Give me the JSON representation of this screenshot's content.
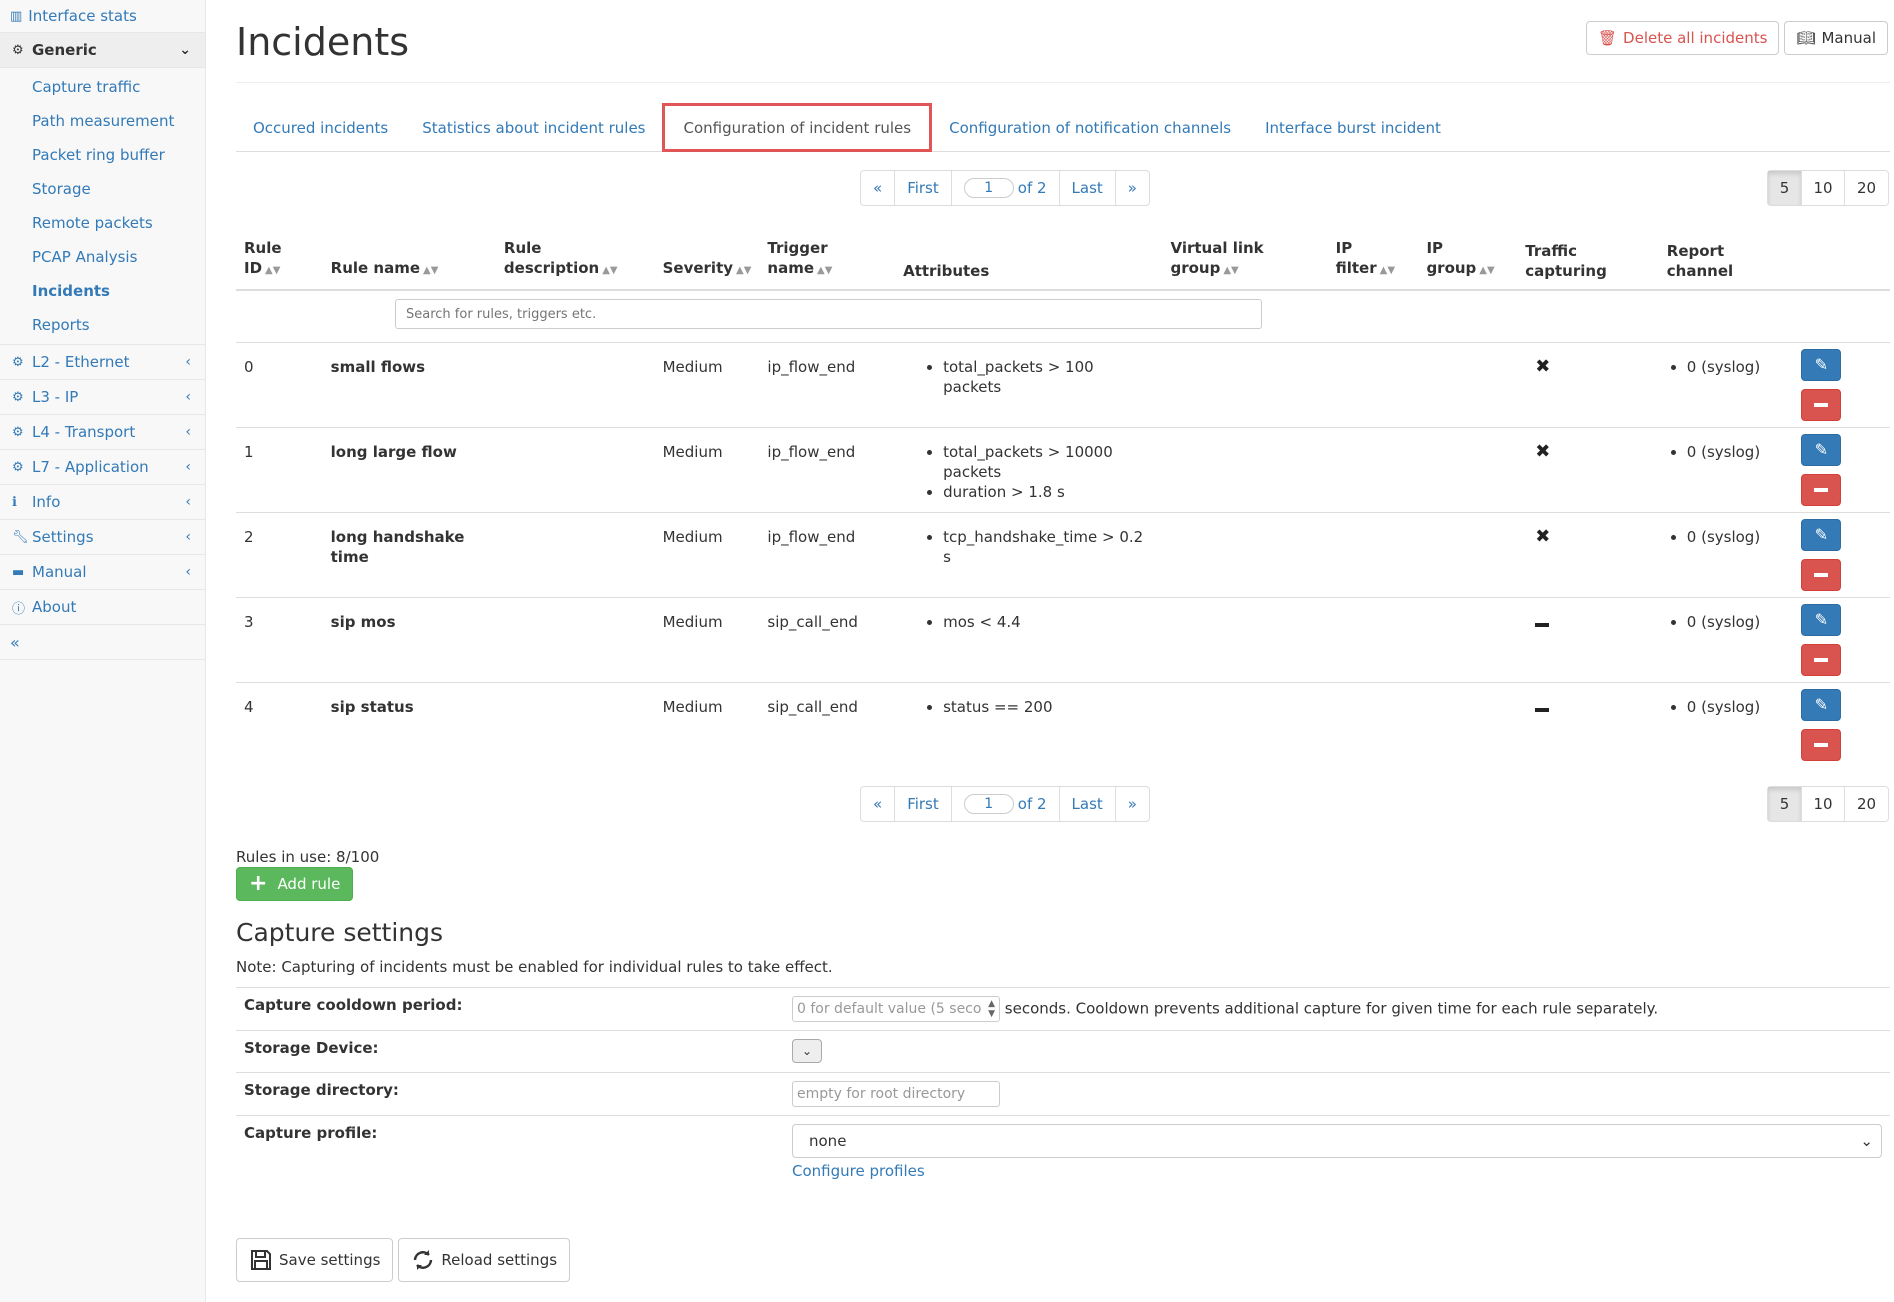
{
  "sidebar": {
    "interface_stats": "Interface stats",
    "generic": {
      "label": "Generic",
      "items": [
        "Capture traffic",
        "Path measurement",
        "Packet ring buffer",
        "Storage",
        "Remote packets",
        "PCAP Analysis",
        "Incidents",
        "Reports"
      ]
    },
    "sections": [
      "L2 - Ethernet",
      "L3 - IP",
      "L4 - Transport",
      "L7 - Application",
      "Info",
      "Settings",
      "Manual",
      "About"
    ],
    "collapse": "«"
  },
  "header": {
    "title": "Incidents",
    "delete_all": "Delete all incidents",
    "manual": "Manual"
  },
  "tabs": [
    "Occured incidents",
    "Statistics about incident rules",
    "Configuration of incident rules",
    "Configuration of notification channels",
    "Interface burst incident"
  ],
  "pager": {
    "prev": "«",
    "first": "First",
    "page": "1",
    "of": "of 2",
    "last": "Last",
    "next": "»",
    "sizes": [
      "5",
      "10",
      "20"
    ],
    "active_size": "5"
  },
  "table": {
    "headers": {
      "id": [
        "Rule",
        "ID"
      ],
      "name": [
        "Rule name"
      ],
      "desc": [
        "Rule",
        "description"
      ],
      "severity": [
        "Severity"
      ],
      "trigger": [
        "Trigger",
        "name"
      ],
      "attributes": [
        "Attributes"
      ],
      "vlink": [
        "Virtual link",
        "group"
      ],
      "ipfilter": [
        "IP",
        "filter"
      ],
      "ipgroup": [
        "IP",
        "group"
      ],
      "traffic": [
        "Traffic",
        "capturing"
      ],
      "report": [
        "Report",
        "channel"
      ]
    },
    "search_placeholder": "Search for rules, triggers etc.",
    "rows": [
      {
        "id": "0",
        "name": "small flows",
        "severity": "Medium",
        "trigger": "ip_flow_end",
        "attributes": [
          "total_packets > 100 packets"
        ],
        "capture": "x",
        "channel": "0 (syslog)"
      },
      {
        "id": "1",
        "name": "long large flow",
        "severity": "Medium",
        "trigger": "ip_flow_end",
        "attributes": [
          "total_packets > 10000 packets",
          "duration > 1.8 s"
        ],
        "capture": "x",
        "channel": "0 (syslog)"
      },
      {
        "id": "2",
        "name": "long handshake time",
        "severity": "Medium",
        "trigger": "ip_flow_end",
        "attributes": [
          "tcp_handshake_time > 0.2 s"
        ],
        "capture": "x",
        "channel": "0 (syslog)"
      },
      {
        "id": "3",
        "name": "sip mos",
        "severity": "Medium",
        "trigger": "sip_call_end",
        "attributes": [
          "mos < 4.4"
        ],
        "capture": "dash",
        "channel": "0 (syslog)"
      },
      {
        "id": "4",
        "name": "sip status",
        "severity": "Medium",
        "trigger": "sip_call_end",
        "attributes": [
          "status == 200"
        ],
        "capture": "dash",
        "channel": "0 (syslog)"
      }
    ]
  },
  "rules_in_use": "Rules in use: 8/100",
  "add_rule": "Add rule",
  "capture": {
    "title": "Capture settings",
    "note": "Note: Capturing of incidents must be enabled for individual rules to take effect.",
    "cooldown_label": "Capture cooldown period:",
    "cooldown_placeholder": "0 for default value (5 seco",
    "cooldown_help": "seconds. Cooldown prevents additional capture for given time for each rule separately.",
    "storage_device_label": "Storage Device:",
    "storage_dir_label": "Storage directory:",
    "storage_dir_placeholder": "empty for root directory",
    "profile_label": "Capture profile:",
    "profile_value": "none",
    "configure_profiles": "Configure profiles"
  },
  "buttons": {
    "save": "Save settings",
    "reload": "Reload settings"
  }
}
